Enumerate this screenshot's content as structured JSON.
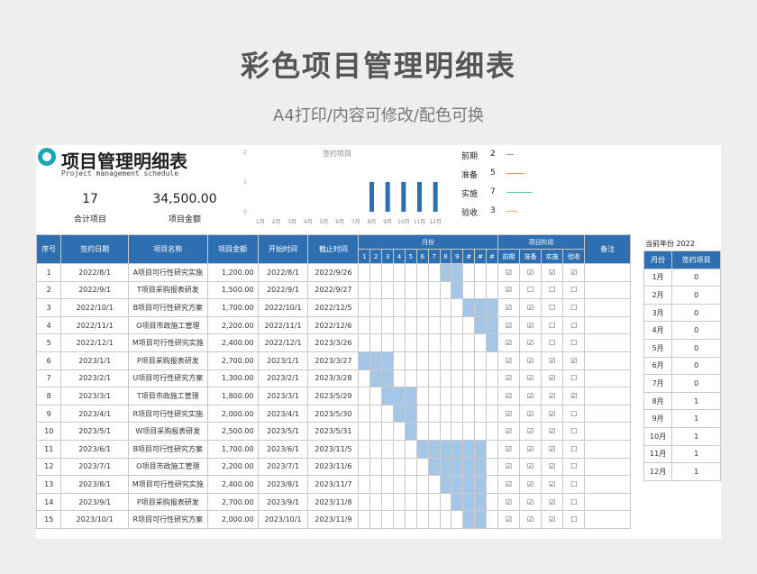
{
  "hero": {
    "title": "彩色项目管理明细表",
    "subtitle": "A4打印/内容可修改/配色可换"
  },
  "sheet": {
    "title": "项目管理明细表",
    "subtitle_en": "Project management schedule",
    "kpis": [
      {
        "value": "17",
        "label": "合计项目"
      },
      {
        "value": "34,500.00",
        "label": "项目金额"
      }
    ],
    "stages": [
      {
        "name": "前期",
        "count": "2",
        "color": "#8e8fe0"
      },
      {
        "name": "准备",
        "count": "5",
        "color": "#f08a5a"
      },
      {
        "name": "实施",
        "count": "7",
        "color": "#5fc4a8"
      },
      {
        "name": "验收",
        "count": "3",
        "color": "#f0b04a"
      }
    ]
  },
  "chart_data": {
    "type": "bar",
    "title": "签约项目",
    "categories": [
      "1月",
      "2月",
      "3月",
      "4月",
      "5月",
      "6月",
      "7月",
      "8月",
      "9月",
      "10月",
      "11月",
      "12月"
    ],
    "values": [
      0,
      0,
      0,
      0,
      0,
      0,
      0,
      1,
      1,
      1,
      1,
      1
    ],
    "y_ticks": [
      "2",
      "1",
      "0"
    ],
    "ylim": [
      0,
      2
    ],
    "bar_color": "#2e6fb2"
  },
  "table": {
    "headers": [
      "序号",
      "签约日期",
      "项目名称",
      "项目金额",
      "开始时间",
      "截止时间",
      "月份",
      "项目阶段",
      "备注"
    ],
    "month_headers": [
      "1",
      "2",
      "3",
      "4",
      "5",
      "6",
      "7",
      "8",
      "9",
      "#",
      "#",
      "#"
    ],
    "stage_headers": [
      "前期",
      "准备",
      "实施",
      "验收"
    ],
    "rows": [
      [
        "1",
        "2022/8/1",
        "A项目可行性研究实施",
        "1,200.00",
        "2022/8/1",
        "2022/9/26"
      ],
      [
        "2",
        "2022/9/1",
        "T项目采购报表研发",
        "1,500.00",
        "2022/9/1",
        "2022/9/27"
      ],
      [
        "3",
        "2022/10/1",
        "B项目可行性研究方案",
        "1,700.00",
        "2022/10/1",
        "2022/12/5"
      ],
      [
        "4",
        "2022/11/1",
        "O项目市政施工管理",
        "2,200.00",
        "2022/11/1",
        "2022/12/6"
      ],
      [
        "5",
        "2022/12/1",
        "M项目可行性研究实施",
        "2,400.00",
        "2022/12/1",
        "2023/3/26"
      ],
      [
        "6",
        "2023/1/1",
        "P项目采购报表研发",
        "2,700.00",
        "2023/1/1",
        "2023/3/27"
      ],
      [
        "7",
        "2023/2/1",
        "U项目可行性研究方案",
        "1,300.00",
        "2023/2/1",
        "2023/3/28"
      ],
      [
        "8",
        "2023/3/1",
        "T项目市政施工管理",
        "1,800.00",
        "2023/3/1",
        "2023/5/29"
      ],
      [
        "9",
        "2023/4/1",
        "R项目可行性研究实施",
        "2,000.00",
        "2023/4/1",
        "2023/5/30"
      ],
      [
        "10",
        "2023/5/1",
        "W项目采购报表研发",
        "2,500.00",
        "2023/5/1",
        "2023/5/31"
      ],
      [
        "11",
        "2023/6/1",
        "B项目可行性研究方案",
        "1,700.00",
        "2023/6/1",
        "2023/11/5"
      ],
      [
        "12",
        "2023/7/1",
        "O项目市政施工管理",
        "2,200.00",
        "2023/7/1",
        "2023/11/6"
      ],
      [
        "13",
        "2023/8/1",
        "M项目可行性研究实施",
        "2,400.00",
        "2023/8/1",
        "2023/11/7"
      ],
      [
        "14",
        "2023/9/1",
        "P项目采购报表研发",
        "2,700.00",
        "2023/9/1",
        "2023/11/8"
      ],
      [
        "15",
        "2023/10/1",
        "R项目可行性研究方案",
        "2,000.00",
        "2023/10/1",
        "2023/11/9"
      ]
    ],
    "month_spans": [
      [
        8,
        9
      ],
      [
        9,
        9
      ],
      [
        10,
        12
      ],
      [
        11,
        12
      ],
      [
        12,
        12
      ],
      [
        1,
        3
      ],
      [
        2,
        3
      ],
      [
        3,
        5
      ],
      [
        4,
        5
      ],
      [
        5,
        5
      ],
      [
        6,
        11
      ],
      [
        7,
        11
      ],
      [
        8,
        11
      ],
      [
        9,
        11
      ],
      [
        10,
        11
      ]
    ],
    "stage_checks": [
      [
        true,
        true,
        true,
        true
      ],
      [
        true,
        false,
        false,
        false
      ],
      [
        true,
        true,
        false,
        false
      ],
      [
        true,
        true,
        false,
        false
      ],
      [
        true,
        true,
        false,
        false
      ],
      [
        true,
        true,
        true,
        true
      ],
      [
        true,
        true,
        true,
        false
      ],
      [
        true,
        true,
        true,
        true
      ],
      [
        true,
        true,
        true,
        false
      ],
      [
        true,
        true,
        true,
        false
      ],
      [
        true,
        true,
        true,
        false
      ],
      [
        true,
        true,
        true,
        false
      ],
      [
        true,
        true,
        true,
        false
      ],
      [
        true,
        true,
        true,
        false
      ],
      [
        true,
        true,
        true,
        false
      ]
    ],
    "check_glyph": "☑",
    "empty_glyph": "☐"
  },
  "side": {
    "current_year_label": "当前年份",
    "current_year": "2022",
    "headers": [
      "月份",
      "签约项目"
    ],
    "rows": [
      [
        "1月",
        "0"
      ],
      [
        "2月",
        "0"
      ],
      [
        "3月",
        "0"
      ],
      [
        "4月",
        "0"
      ],
      [
        "5月",
        "0"
      ],
      [
        "6月",
        "0"
      ],
      [
        "7月",
        "0"
      ],
      [
        "8月",
        "1"
      ],
      [
        "9月",
        "1"
      ],
      [
        "10月",
        "1"
      ],
      [
        "11月",
        "1"
      ],
      [
        "12月",
        "1"
      ]
    ]
  }
}
